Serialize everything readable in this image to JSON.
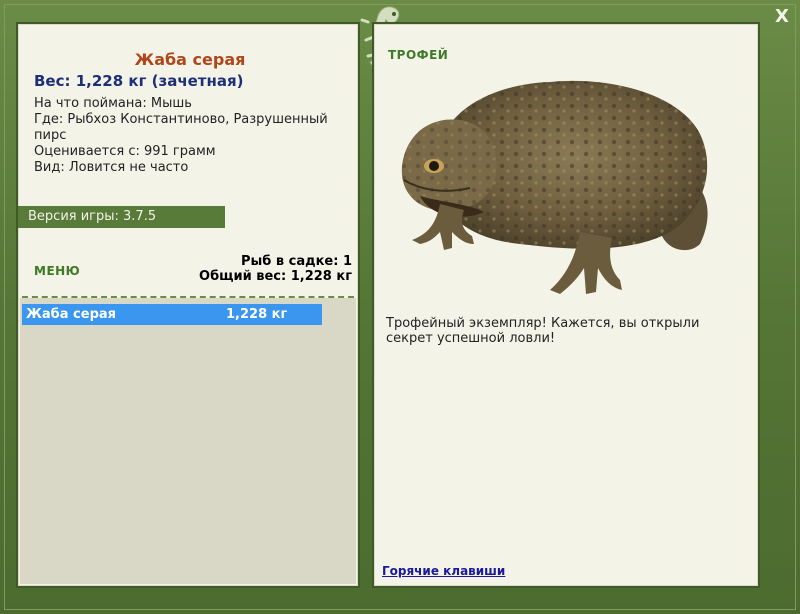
{
  "fish": {
    "name": "Жаба серая",
    "weight_line": "Вес: 1,228 кг (зачетная)",
    "details": [
      "На что поймана: Мышь",
      "Где: Рыбхоз Константиново, Разрушенный пирс",
      "Оценивается с: 991 грамм",
      "Вид: Ловится не часто"
    ]
  },
  "version": "Версия игры: 3.7.5",
  "menu": {
    "label": "МЕНЮ"
  },
  "sadok": {
    "count_line": "Рыб в садке: 1",
    "total_line": "Общий вес: 1,228 кг"
  },
  "catch_list": [
    {
      "name": "Жаба серая",
      "weight": "1,228 кг"
    }
  ],
  "trophy": {
    "label": "ТРОФЕЙ",
    "text": "Трофейный экземпляр! Кажется, вы открыли секрет успешной ловли!"
  },
  "hotkeys": "Горячие клавиши",
  "close": "X",
  "colors": {
    "frame": "#587b3a",
    "panel": "#f4f3e8",
    "title": "#b0461a",
    "weight": "#1c2f77",
    "selection": "#3a96ee",
    "link": "#1a1a9a"
  },
  "icons": [
    "gecko-logo-icon",
    "close-icon",
    "toad-image"
  ]
}
